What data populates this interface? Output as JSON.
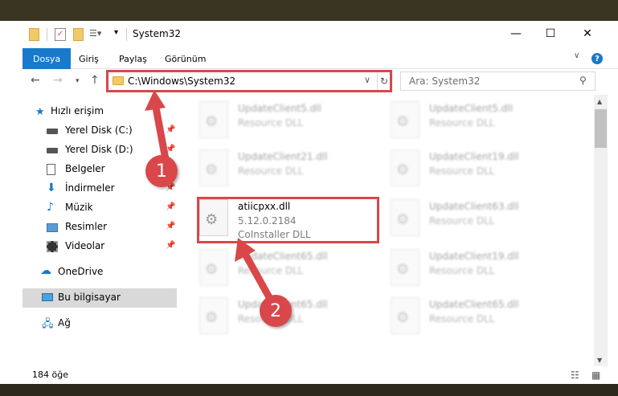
{
  "window": {
    "title": "System32"
  },
  "ribbon": {
    "tabs": [
      "Dosya",
      "Giriş",
      "Paylaş",
      "Görünüm"
    ],
    "help_glyph": "?"
  },
  "address": {
    "path": "C:\\Windows\\System32"
  },
  "search": {
    "placeholder": "Ara: System32"
  },
  "sidebar": {
    "items": [
      {
        "label": "Hızlı erişim",
        "icon": "star-icon"
      },
      {
        "label": "Yerel Disk (C:)",
        "icon": "drive-icon"
      },
      {
        "label": "Yerel Disk (D:)",
        "icon": "drive-icon"
      },
      {
        "label": "Belgeler",
        "icon": "document-icon"
      },
      {
        "label": "İndirmeler",
        "icon": "download-icon"
      },
      {
        "label": "Müzik",
        "icon": "music-icon"
      },
      {
        "label": "Resimler",
        "icon": "picture-icon"
      },
      {
        "label": "Videolar",
        "icon": "video-icon"
      },
      {
        "label": "OneDrive",
        "icon": "cloud-icon"
      },
      {
        "label": "Bu bilgisayar",
        "icon": "computer-icon"
      },
      {
        "label": "Ağ",
        "icon": "network-icon"
      }
    ]
  },
  "files": [
    {
      "name": "UpdateClient5.dll",
      "desc": "Resource DLL"
    },
    {
      "name": "UpdateClient5.dll",
      "desc": "Resource DLL"
    },
    {
      "name": "UpdateClient21.dll",
      "desc": "Resource DLL"
    },
    {
      "name": "UpdateClient19.dll",
      "desc": "Resource DLL"
    },
    {
      "name": "atiicpxx.dll",
      "version": "5.12.0.2184",
      "desc": "CoInstaller DLL"
    },
    {
      "name": "UpdateClient63.dll",
      "desc": "Resource DLL"
    },
    {
      "name": "UpdateClient65.dll",
      "desc": "Resource DLL"
    },
    {
      "name": "UpdateClient19.dll",
      "desc": "Resource DLL"
    },
    {
      "name": "UpdateClient65.dll",
      "desc": "Resource DLL"
    },
    {
      "name": "UpdateClient65.dll",
      "desc": "Resource DLL"
    }
  ],
  "status": {
    "count": "184 öğe"
  },
  "annotations": {
    "step1": "1",
    "step2": "2"
  },
  "colors": {
    "accent": "#1979ca",
    "highlight": "#d9474a"
  }
}
